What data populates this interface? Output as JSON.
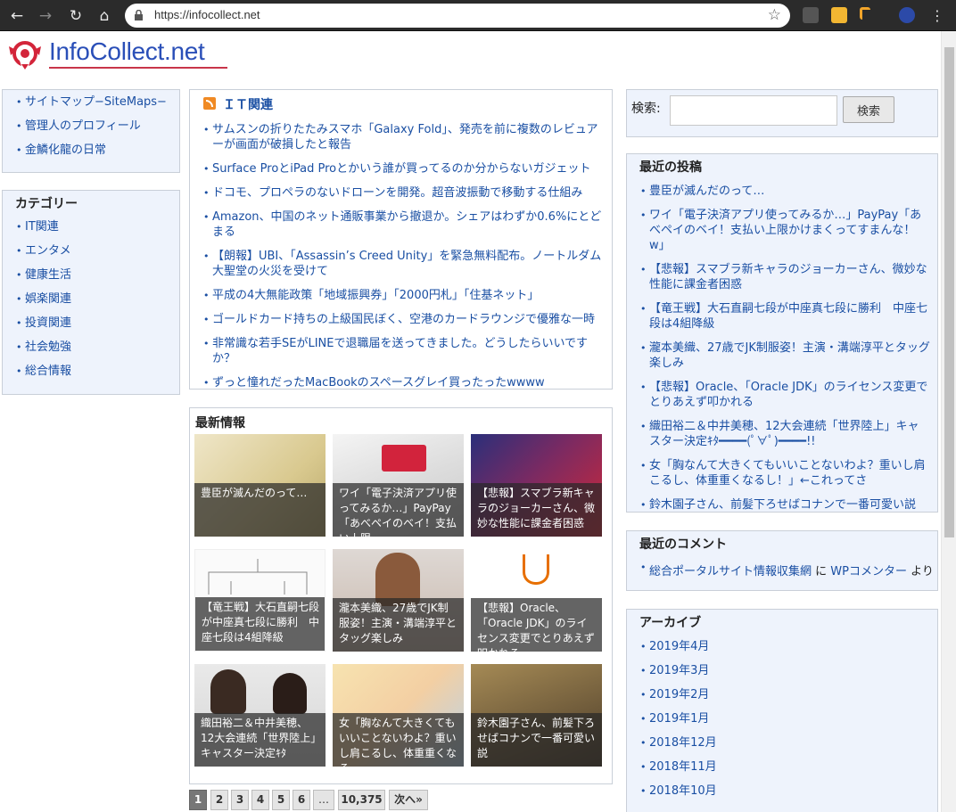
{
  "browser": {
    "url": "https://infocollect.net"
  },
  "site": {
    "name": "InfoCollect.net"
  },
  "left_links": [
    {
      "label": "サイトマップ−SiteMaps−"
    },
    {
      "label": "管理人のプロフィール"
    },
    {
      "label": "金鱗化龍の日常"
    }
  ],
  "categories": {
    "title": "カテゴリー",
    "items": [
      {
        "label": "IT関連"
      },
      {
        "label": "エンタメ"
      },
      {
        "label": "健康生活"
      },
      {
        "label": "娯楽関連"
      },
      {
        "label": "投資関連"
      },
      {
        "label": "社会勉強"
      },
      {
        "label": "総合情報"
      }
    ]
  },
  "it_section": {
    "title": "ＩＴ関連",
    "items": [
      {
        "label": "サムスンの折りたたみスマホ「Galaxy Fold」、発売を前に複数のレビュアーが画面が破損したと報告"
      },
      {
        "label": "Surface ProとiPad Proとかいう誰が買ってるのか分からないガジェット"
      },
      {
        "label": "ドコモ、プロペラのないドローンを開発。超音波振動で移動する仕組み"
      },
      {
        "label": "Amazon、中国のネット通販事業から撤退か。シェアはわずか0.6%にとどまる"
      },
      {
        "label": "【朗報】UBI、「Assassin’s Creed Unity」を緊急無料配布。ノートルダム大聖堂の火災を受けて"
      },
      {
        "label": "平成の4大無能政策「地域振興券」「2000円札」「住基ネット」"
      },
      {
        "label": "ゴールドカード持ちの上級国民ぼく、空港のカードラウンジで優雅な一時"
      },
      {
        "label": "非常識な若手SEがLINEで退職届を送ってきました。どうしたらいいですか？"
      },
      {
        "label": "ずっと憧れだったMacBookのスペースグレイ買ったったwwww"
      }
    ]
  },
  "latest": {
    "title": "最新情報",
    "tiles": [
      {
        "caption": "豊臣が滅んだのって…"
      },
      {
        "caption": "ワイ「電子決済アプリ使ってみるか…」PayPay「あべペイのベイ！支払い上限"
      },
      {
        "caption": "【悲報】スマブラ新キャラのジョーカーさん、微妙な性能に課金者困惑"
      },
      {
        "caption": "【竜王戦】大石直嗣七段が中座真七段に勝利　中座七段は4組降級"
      },
      {
        "caption": "瀧本美織、27歳でJK制服姿！主演・溝端淳平とタッグ楽しみ"
      },
      {
        "caption": "【悲報】Oracle、「Oracle JDK」のライセンス変更でとりあえず叩かれる"
      },
      {
        "caption": "織田裕二＆中井美穂、12大会連続「世界陸上」キャスター決定ｷﾀ"
      },
      {
        "caption": "女「胸なんて大きくてもいいことないわよ？重いし肩こるし、体重重くなる"
      },
      {
        "caption": "鈴木園子さん、前髪下ろせばコナンで一番可愛い説"
      }
    ]
  },
  "pagination": [
    "1",
    "2",
    "3",
    "4",
    "5",
    "6",
    "…",
    "10,375",
    "次へ»"
  ],
  "search": {
    "label": "検索:",
    "button": "検索",
    "value": ""
  },
  "recent_posts": {
    "title": "最近の投稿",
    "items": [
      {
        "label": "豊臣が滅んだのって…"
      },
      {
        "label": "ワイ「電子決済アプリ使ってみるか…」PayPay「あべペイのベイ！支払い上限かけまくってすまんな！w」"
      },
      {
        "label": "【悲報】スマブラ新キャラのジョーカーさん、微妙な性能に課金者困惑"
      },
      {
        "label": "【竜王戦】大石直嗣七段が中座真七段に勝利　中座七段は4組降級"
      },
      {
        "label": "瀧本美織、27歳でJK制服姿！主演・溝端淳平とタッグ楽しみ"
      },
      {
        "label": "【悲報】Oracle、「Oracle JDK」のライセンス変更でとりあえず叩かれる"
      },
      {
        "label": "織田裕二＆中井美穂、12大会連続「世界陸上」キャスター決定ｷﾀ━━━━(ﾟ∀ﾟ)━━━━!!"
      },
      {
        "label": "女「胸なんて大きくてもいいことないわよ？重いし肩こるし、体重重くなるし！」←これってさ"
      },
      {
        "label": "鈴木園子さん、前髪下ろせばコナンで一番可愛い説"
      }
    ]
  },
  "recent_comments": {
    "title": "最近のコメント",
    "author": "総合ポータルサイト情報収集網",
    "middle": " に ",
    "post": "WPコメンター",
    "suffix": " より"
  },
  "archive": {
    "title": "アーカイブ",
    "items": [
      {
        "label": "2019年4月"
      },
      {
        "label": "2019年3月"
      },
      {
        "label": "2019年2月"
      },
      {
        "label": "2019年1月"
      },
      {
        "label": "2018年12月"
      },
      {
        "label": "2018年11月"
      },
      {
        "label": "2018年10月"
      }
    ]
  },
  "colors": {
    "link": "#1a4fa3",
    "widget_bg": "#eef3fc",
    "logo_blue": "#2a4fb8",
    "logo_red": "#c8354a"
  }
}
